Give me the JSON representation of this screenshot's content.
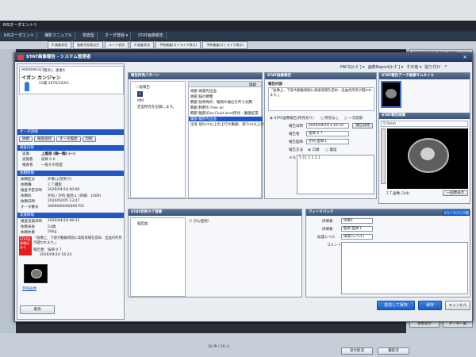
{
  "background": {
    "title": "RISオーダエントリ",
    "menu": [
      "RISオーダエント",
      "撮影マニュアル",
      "検査型",
      "オーダ登録 ▾",
      "STAT画像報告"
    ],
    "tabs": [
      "X 検査状況",
      "画像予定表出力",
      "ルート状況",
      "X 検査状況",
      "予約検査(ストライク表示)",
      "予約検査(ストライク表示)"
    ],
    "right_cards": [
      "900000000321 西浜し 患者A",
      "イガン カンジャン",
      "900000000321 西浜し 患者B"
    ],
    "right_buttons": [
      "患者表示",
      "オーダ一覧"
    ],
    "bottom_buttons": [
      "受付取消",
      "撮影済"
    ]
  },
  "modal": {
    "title": "STAT画像報告 - システム管理者",
    "patient": {
      "id": "9000000321",
      "name_kana": "イガン カンジャン",
      "sex_age": "53歳 1970/12/01",
      "name": "西浜し 患者A"
    },
    "order_section": "オーダ詳細",
    "order_tabs": [
      "依頼",
      "検査進捗",
      "オーダ履歴",
      "印刷"
    ],
    "exam_content_header": "検査内容",
    "exam_rows": [
      [
        "実施",
        "上腹部 (胸一胸) (一)"
      ],
      [
        "実施者",
        "技師 0 6"
      ],
      [
        "検査者",
        "一般その他室"
      ]
    ],
    "request_header": "依頼情報",
    "request_rows": [
      [
        "依頼区分",
        "外来(入院有り)"
      ],
      [
        "依頼種",
        "ＣＴ撮影"
      ],
      [
        "検査予定日時",
        "2026/04/18 00:00"
      ],
      [
        "依頼科",
        "外科 / 外科 医師１ (内線：1009)"
      ],
      [
        "依頼日時",
        "2024/02/05 13:47"
      ],
      [
        "オーダ番号",
        "3900000000000703"
      ]
    ],
    "exec_header": "実施情報",
    "exec_rows": [
      [
        "検査実施日時",
        "2026/04/18 09:31"
      ],
      [
        "依頼身長",
        "53歳"
      ],
      [
        "依頼体重",
        "50kg"
      ]
    ],
    "stat_label": "STAT画像報告あり",
    "stat_text": "「画像上、下部大動脈周囲に高吸収域を認め、出血の所見が疑われます。」",
    "stat_reporter": "報告者：技師 0 7",
    "stat_date": "2026/04/16 16:24",
    "thumb_label": "参照画像",
    "cancel_button": "取消",
    "pattern_header": "報告所見パターン",
    "pattern_category": "一般報告",
    "pattern_selected_item": "MRI",
    "pattern_note": "定型所見を記録します。",
    "pattern_list_header": [
      "",
      "疑疑"
    ],
    "pattern_list": [
      "頭部 頭蓋内出血",
      "頭部 脳の梗塞",
      "胸部 肋骨骨折、縦隔の偏位を伴う気胸",
      "胸部 肺野の Free air",
      "胸部 腹部(Dsa Fluid level所見・腹膜拡張",
      "腹部 腹腔内出血",
      "全身 径6cm以上の上行大動脈、径7cm以上の下"
    ],
    "pattern_selected_index": 5,
    "stat_panel_header": "STAT画像報告",
    "report_section": "報告内容",
    "report_text": "「画像上、下部大動脈周囲に高吸収域を認め、出血の所見が疑われます。」",
    "report_radio": [
      "STAT画像報告(所見あり)",
      "所見なし",
      "一次読影"
    ],
    "fields": {
      "date_label": "報告日時",
      "date_value": "2026/04/16 ▾ 16:24",
      "date_button": "現在日時",
      "reporter_label": "報告者",
      "reporter_value": "技師 0 7",
      "doctor_label": "報告医師",
      "doctor_value": "外科 医師１",
      "method_label": "報告方法",
      "method_options": [
        "口頭",
        "電話"
      ],
      "memo_label": "メモ",
      "memo_value": "ﾜｰｸ1 1 1 1 1"
    },
    "toolbar": [
      "PACS[ｵｰﾀﾞ] ▾",
      "画像Report[ｵｰﾀﾞ] ▾",
      "その他 ▾",
      "貼り付け",
      "↗"
    ],
    "thumbnail_header": "STAT報告データ画像サムネイル",
    "viewer_header": "STAT報告画像",
    "viewer_label": "5.5mm",
    "viewer_button": "一画像表示",
    "viewer_footer": "ＩＴ画像 (3/4)",
    "tag_header": "STAT症例タグ登録",
    "tag_item": "脳出血",
    "tag_checkbox": "がん症例！",
    "feedback_header": "フィードバック",
    "feedback_button": "フィードバック登録",
    "feedback_rows": [
      [
        "評価者",
        "評価1"
      ],
      [
        "評価者",
        "医師 医師１"
      ],
      [
        "処理レベル",
        "再案(レベル)"
      ]
    ],
    "feedback_comment_label": "コメント",
    "buttons": {
      "send_save": "送信して保存",
      "save": "保存",
      "cancel": "キャンセル"
    }
  },
  "footer": {
    "page": "16 件 / 16 人"
  }
}
